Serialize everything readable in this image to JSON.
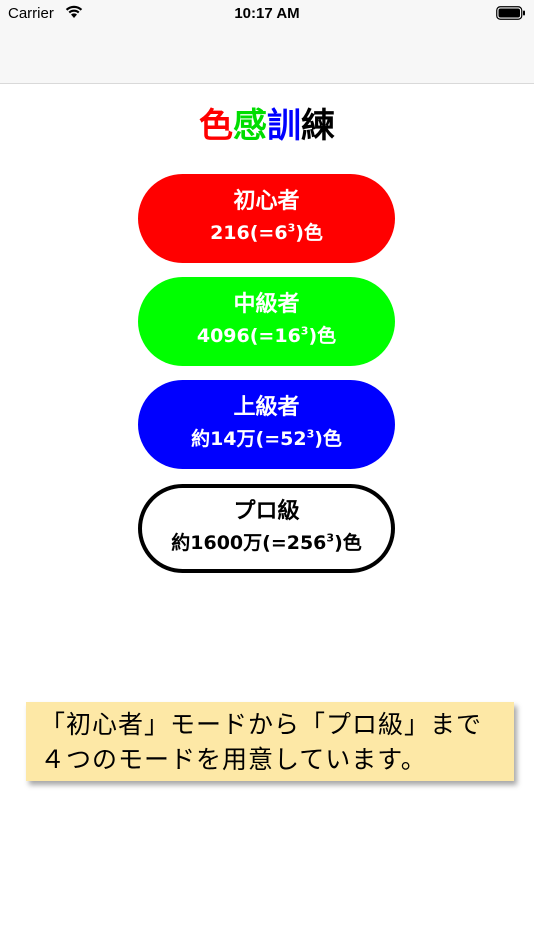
{
  "status_bar": {
    "carrier": "Carrier",
    "time": "10:17 AM",
    "wifi_icon": "wifi-icon",
    "battery_icon": "battery-icon"
  },
  "title": {
    "chars": [
      "色",
      "感",
      "訓",
      "練"
    ],
    "colors": [
      "#ff0000",
      "#00dd00",
      "#0000ff",
      "#000000"
    ]
  },
  "modes": [
    {
      "name": "初心者",
      "count_prefix": "216(=6",
      "count_exp": "3",
      "count_suffix": ")色",
      "color": "#ff0000"
    },
    {
      "name": "中級者",
      "count_prefix": "4096(=16",
      "count_exp": "3",
      "count_suffix": ")色",
      "color": "#00ff00"
    },
    {
      "name": "上級者",
      "count_prefix": "約14万(=52",
      "count_exp": "3",
      "count_suffix": ")色",
      "color": "#0000ff"
    },
    {
      "name": "プロ級",
      "count_prefix": "約1600万(=256",
      "count_exp": "3",
      "count_suffix": ")色",
      "color": "#ffffff"
    }
  ],
  "note": {
    "line1": "「初心者」モードから「プロ級」まで",
    "line2": "４つのモードを用意しています。"
  }
}
